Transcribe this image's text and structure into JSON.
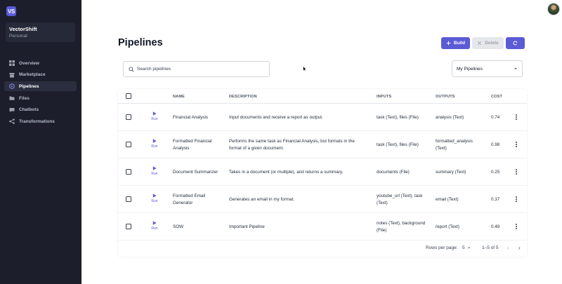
{
  "sidebar": {
    "logo": "VS",
    "workspace": {
      "name": "VectorShift",
      "plan": "Personal"
    },
    "items": [
      {
        "label": "Overview",
        "icon": "grid-icon"
      },
      {
        "label": "Marketplace",
        "icon": "store-icon"
      },
      {
        "label": "Pipelines",
        "icon": "pipeline-icon",
        "active": true
      },
      {
        "label": "Files",
        "icon": "folder-icon"
      },
      {
        "label": "Chatbots",
        "icon": "chat-icon"
      },
      {
        "label": "Transformations",
        "icon": "transform-icon"
      }
    ]
  },
  "header": {
    "title": "Pipelines",
    "build_label": "Build",
    "delete_label": "Delete"
  },
  "filters": {
    "search_placeholder": "Search pipelines",
    "select_value": "My Pipelines"
  },
  "table": {
    "columns": [
      "NAME",
      "DESCRIPTION",
      "INPUTS",
      "OUTPUTS",
      "COST"
    ],
    "run_label": "Run",
    "rows": [
      {
        "name": "Financial Analysis",
        "description": "Input documents and receive a report as output.",
        "inputs": "task (Text), files (File)",
        "outputs": "analysis (Text)",
        "cost": "0.74"
      },
      {
        "name": "Formatted Financial Analysis",
        "description": "Performs the same task as Financial Analysis, but formats in the format of a given document.",
        "inputs": "task (Text), files (File)",
        "outputs": "formatted_analysis (Text)",
        "cost": "0.98"
      },
      {
        "name": "Document Summarizer",
        "description": "Takes in a document (or multiple), and returns a summary.",
        "inputs": "documents (File)",
        "outputs": "summary (Text)",
        "cost": "0.25"
      },
      {
        "name": "Formatted Email Generator",
        "description": "Generates an email in my format.",
        "inputs": "youtube_url (Text), task (Text)",
        "outputs": "email (Text)",
        "cost": "0.37"
      },
      {
        "name": "SOW",
        "description": "Important Pipeline",
        "inputs": "notes (Text), background (File)",
        "outputs": "report (Text)",
        "cost": "0.49"
      }
    ],
    "footer": {
      "rows_per_page_label": "Rows per page:",
      "rows_per_page_value": "5",
      "range": "1–5 of 5"
    }
  },
  "colors": {
    "accent": "#5b5bd6",
    "sidebar_bg": "#1c1e2b"
  }
}
